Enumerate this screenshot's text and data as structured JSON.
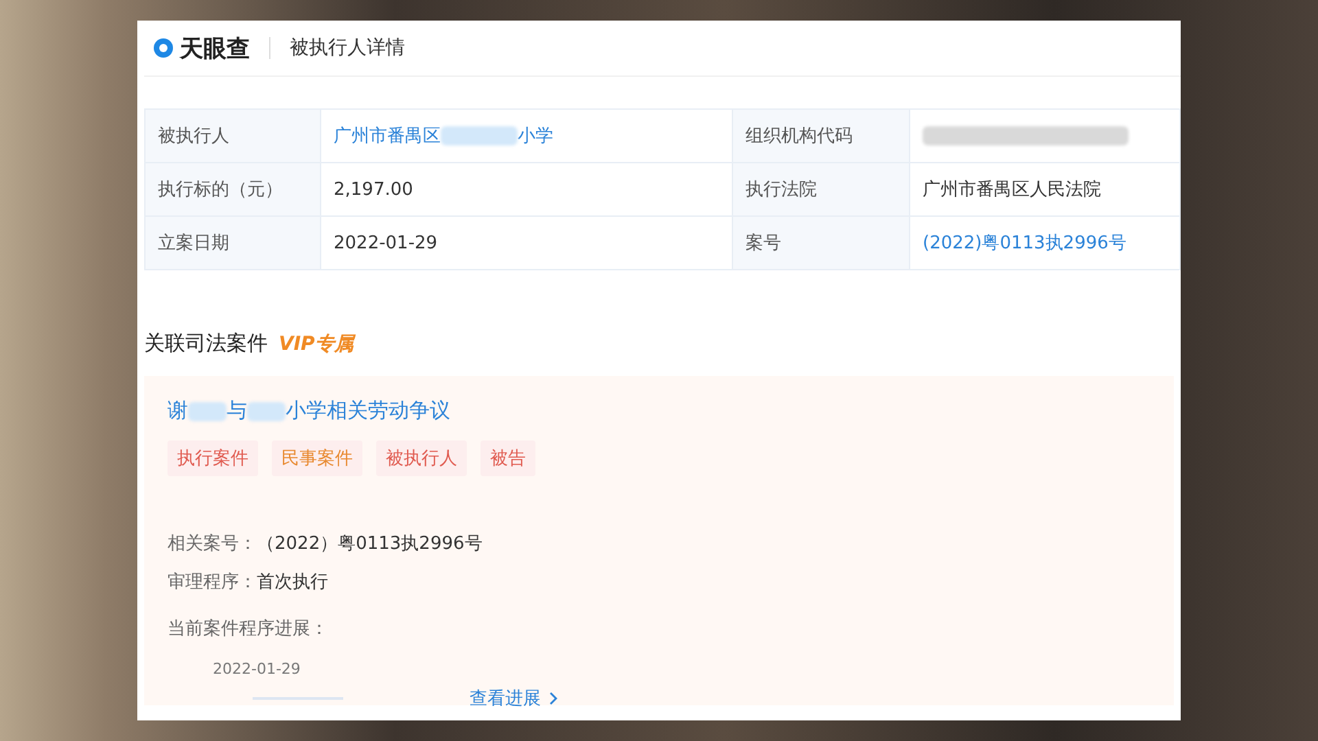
{
  "header": {
    "logo": "天眼查",
    "title": "被执行人详情"
  },
  "details": {
    "rows": [
      {
        "cells": [
          {
            "label": "被执行人",
            "segments": [
              {
                "kind": "link",
                "text": "广州市番禺区"
              },
              {
                "kind": "redacted"
              },
              {
                "kind": "link",
                "text": "小学"
              }
            ]
          },
          {
            "label": "组织机构代码",
            "segments": [
              {
                "kind": "redacted"
              }
            ]
          }
        ]
      },
      {
        "cells": [
          {
            "label": "执行标的（元）",
            "segments": [
              {
                "kind": "text",
                "text": "2,197.00"
              }
            ]
          },
          {
            "label": "执行法院",
            "segments": [
              {
                "kind": "text",
                "text": "广州市番禺区人民法院"
              }
            ]
          }
        ]
      },
      {
        "cells": [
          {
            "label": "立案日期",
            "segments": [
              {
                "kind": "text",
                "text": "2022-01-29"
              }
            ]
          },
          {
            "label": "案号",
            "segments": [
              {
                "kind": "link",
                "text": "(2022)粤0113执2996号"
              }
            ]
          }
        ]
      }
    ]
  },
  "related": {
    "title": "关联司法案件",
    "badge": "VIP专属",
    "case": {
      "title_parts": [
        "谢",
        "与",
        "小学相关劳动争议"
      ],
      "tags": [
        {
          "label": "执行案件",
          "color": "#e05a4f"
        },
        {
          "label": "民事案件",
          "color": "#e8892f"
        },
        {
          "label": "被执行人",
          "color": "#e05a4f"
        },
        {
          "label": "被告",
          "color": "#e05a4f"
        }
      ],
      "fields": [
        {
          "label": "相关案号：",
          "value": "（2022）粤0113执2996号"
        },
        {
          "label": "审理程序：",
          "value": "首次执行"
        }
      ],
      "progress_label": "当前案件程序进展：",
      "progress_date": "2022-01-29",
      "progress_link": "查看进展"
    }
  }
}
